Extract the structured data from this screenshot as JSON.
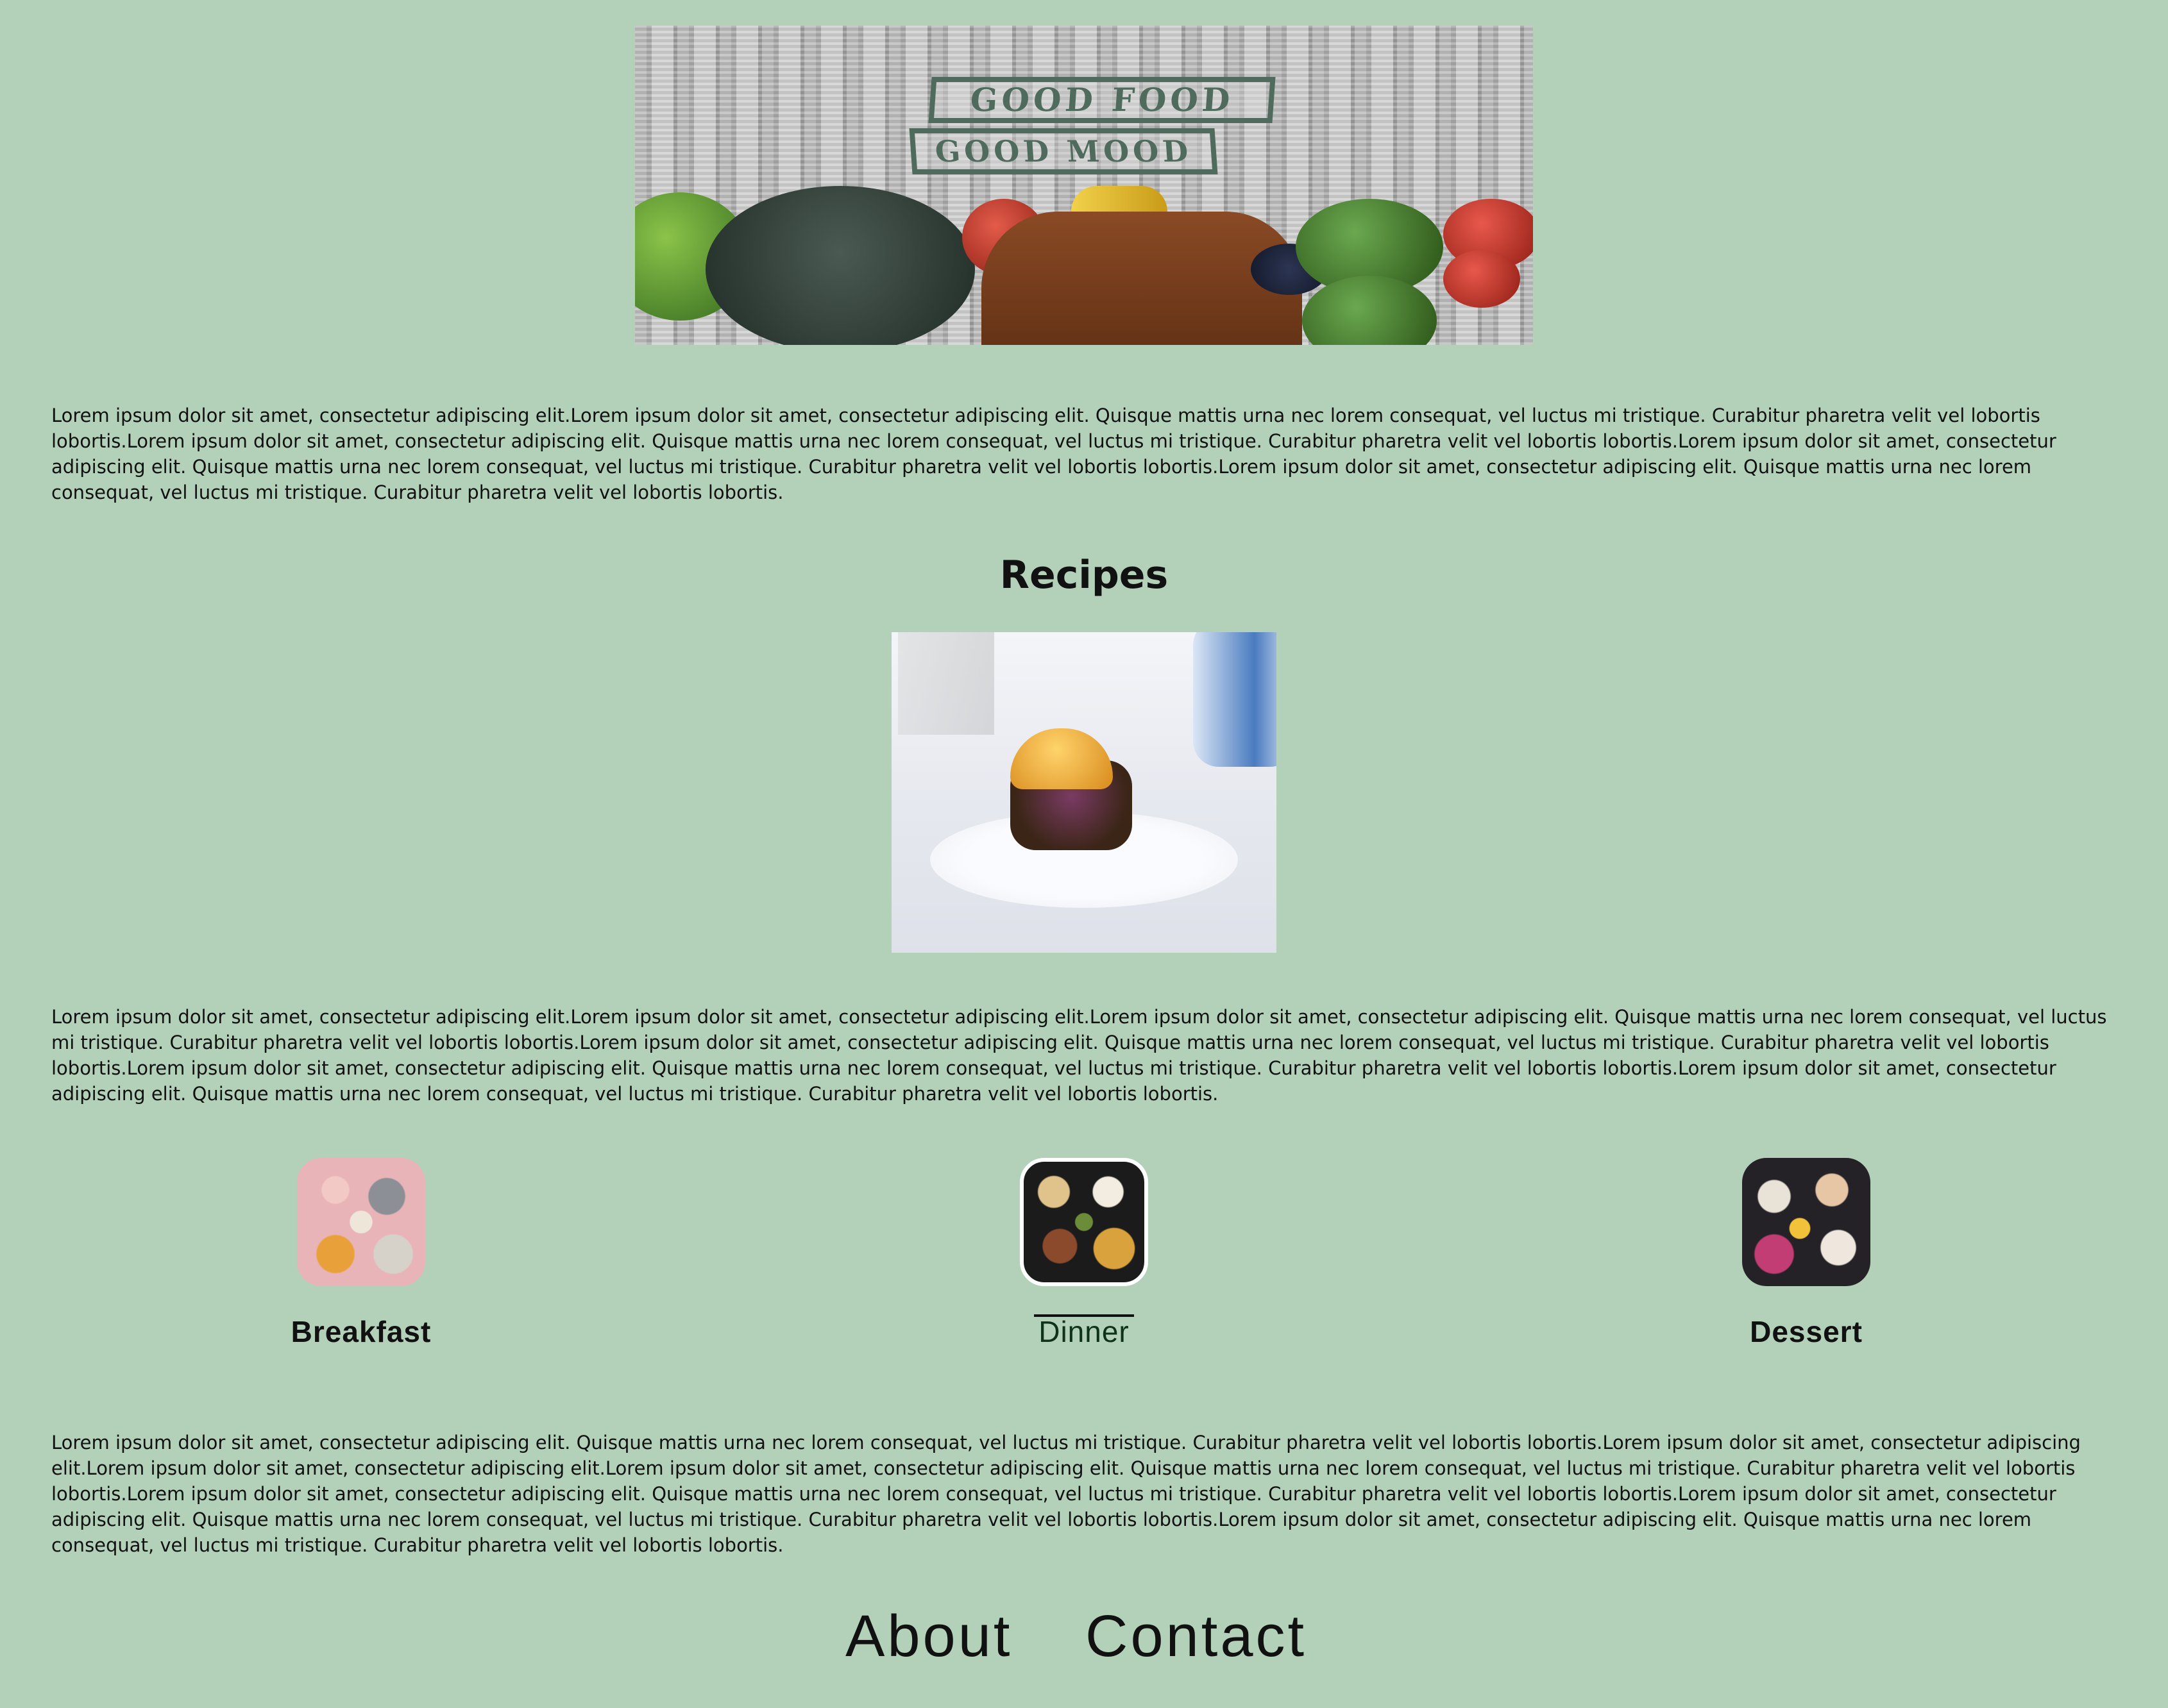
{
  "banner": {
    "title_line1": "GOOD FOOD",
    "title_line2": "GOOD MOOD"
  },
  "intro_text": "Lorem ipsum dolor sit amet, consectetur adipiscing elit.Lorem ipsum dolor sit amet, consectetur adipiscing elit. Quisque mattis urna nec lorem consequat, vel luctus mi tristique. Curabitur pharetra velit vel lobortis lobortis.Lorem ipsum dolor sit amet, consectetur adipiscing elit. Quisque mattis urna nec lorem consequat, vel luctus mi tristique. Curabitur pharetra velit vel lobortis lobortis.Lorem ipsum dolor sit amet, consectetur adipiscing elit. Quisque mattis urna nec lorem consequat, vel luctus mi tristique. Curabitur pharetra velit vel lobortis lobortis.Lorem ipsum dolor sit amet, consectetur adipiscing elit. Quisque mattis urna nec lorem consequat, vel luctus mi tristique. Curabitur pharetra velit vel lobortis lobortis.",
  "recipes_heading": "Recipes",
  "recipes_text": "Lorem ipsum dolor sit amet, consectetur adipiscing elit.Lorem ipsum dolor sit amet, consectetur adipiscing elit.Lorem ipsum dolor sit amet, consectetur adipiscing elit. Quisque mattis urna nec lorem consequat, vel luctus mi tristique. Curabitur pharetra velit vel lobortis lobortis.Lorem ipsum dolor sit amet, consectetur adipiscing elit. Quisque mattis urna nec lorem consequat, vel luctus mi tristique. Curabitur pharetra velit vel lobortis lobortis.Lorem ipsum dolor sit amet, consectetur adipiscing elit. Quisque mattis urna nec lorem consequat, vel luctus mi tristique. Curabitur pharetra velit vel lobortis lobortis.Lorem ipsum dolor sit amet, consectetur adipiscing elit. Quisque mattis urna nec lorem consequat, vel luctus mi tristique. Curabitur pharetra velit vel lobortis lobortis.",
  "categories": [
    {
      "label": "Breakfast"
    },
    {
      "label": "Dinner"
    },
    {
      "label": "Dessert"
    }
  ],
  "bottom_text": "Lorem ipsum dolor sit amet, consectetur adipiscing elit. Quisque mattis urna nec lorem consequat, vel luctus mi tristique. Curabitur pharetra velit vel lobortis lobortis.Lorem ipsum dolor sit amet, consectetur adipiscing elit.Lorem ipsum dolor sit amet, consectetur adipiscing elit.Lorem ipsum dolor sit amet, consectetur adipiscing elit. Quisque mattis urna nec lorem consequat, vel luctus mi tristique. Curabitur pharetra velit vel lobortis lobortis.Lorem ipsum dolor sit amet, consectetur adipiscing elit. Quisque mattis urna nec lorem consequat, vel luctus mi tristique. Curabitur pharetra velit vel lobortis lobortis.Lorem ipsum dolor sit amet, consectetur adipiscing elit. Quisque mattis urna nec lorem consequat, vel luctus mi tristique. Curabitur pharetra velit vel lobortis lobortis.Lorem ipsum dolor sit amet, consectetur adipiscing elit. Quisque mattis urna nec lorem consequat, vel luctus mi tristique. Curabitur pharetra velit vel lobortis lobortis.",
  "footer_nav": {
    "about": "About",
    "contact": "Contact"
  },
  "colors": {
    "background": "#b3d1b9",
    "banner_ink": "#4f6b5d",
    "text": "#111111"
  }
}
